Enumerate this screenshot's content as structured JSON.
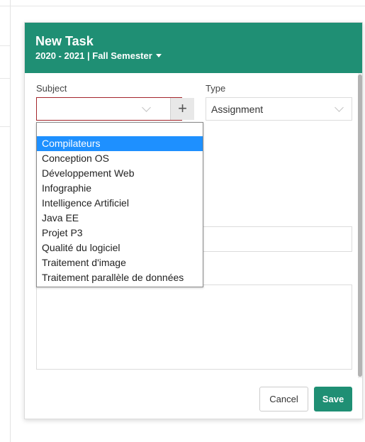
{
  "modal": {
    "title": "New Task",
    "subtitle": "2020 - 2021 | Fall Semester",
    "header_color": "#1f8f74"
  },
  "form": {
    "subject_label": "Subject",
    "subject_value": "",
    "add_subject_symbol": "+",
    "type_label": "Type",
    "type_value": "Assignment"
  },
  "subject_options": [
    "Compilateurs",
    "Conception OS",
    "Développement Web",
    "Infographie",
    "Intelligence Artificiel",
    "Java EE",
    "Projet P3",
    "Qualité du logiciel",
    "Traitement d'image",
    "Traitement parallèle de données"
  ],
  "highlighted_option": "Compilateurs",
  "buttons": {
    "cancel": "Cancel",
    "save": "Save"
  },
  "icons": {
    "subtitle_caret": "caret-down-icon",
    "subject_chevron": "chevron-down-icon",
    "type_chevron": "chevron-down-icon",
    "add": "plus-icon"
  }
}
